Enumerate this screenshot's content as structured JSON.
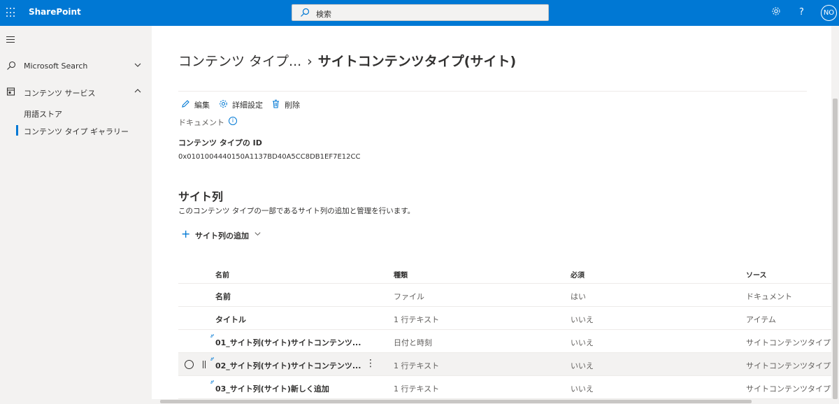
{
  "topbar": {
    "brand": "SharePoint",
    "search_placeholder": "検索",
    "avatar_initials": "NO",
    "help_label": "?",
    "color": "#0078d4"
  },
  "sidebar": {
    "items": [
      {
        "label": "Microsoft Search",
        "expanded": false
      },
      {
        "label": "コンテンツ サービス",
        "expanded": true
      }
    ],
    "subitems": [
      {
        "label": "用語ストア",
        "active": false
      },
      {
        "label": "コンテンツ タイプ ギャラリー",
        "active": true
      }
    ]
  },
  "breadcrumb": {
    "parent": "コンテンツ タイプ...",
    "separator": "›",
    "current": "サイトコンテンツタイプ(サイト)"
  },
  "commands": {
    "edit": "編集",
    "advanced": "詳細設定",
    "delete": "削除"
  },
  "detail": {
    "parent_type": "ドキュメント",
    "id_label": "コンテンツ タイプの ID",
    "id_value": "0x0101004440150A1137BD40A5CC8DB1EF7E12CC"
  },
  "site_columns": {
    "title": "サイト列",
    "description": "このコンテンツ タイプの一部であるサイト列の追加と管理を行います。",
    "add_label": "サイト列の追加",
    "headers": [
      "名前",
      "種類",
      "必須",
      "ソース"
    ],
    "rows": [
      {
        "name": "名前",
        "type": "ファイル",
        "required": "はい",
        "source": "ドキュメント",
        "new": false
      },
      {
        "name": "タイトル",
        "type": "1 行テキスト",
        "required": "いいえ",
        "source": "アイテム",
        "new": false
      },
      {
        "name": "01_サイト列(サイト)サイトコンテンツ...",
        "type": "日付と時刻",
        "required": "いいえ",
        "source": "サイトコンテンツタイプ(",
        "new": true
      },
      {
        "name": "02_サイト列(サイト)サイトコンテンツ...",
        "type": "1 行テキスト",
        "required": "いいえ",
        "source": "サイトコンテンツタイプ(",
        "new": true
      },
      {
        "name": "03_サイト列(サイト)新しく追加",
        "type": "1 行テキスト",
        "required": "いいえ",
        "source": "サイトコンテンツタイプ(",
        "new": true
      }
    ]
  }
}
